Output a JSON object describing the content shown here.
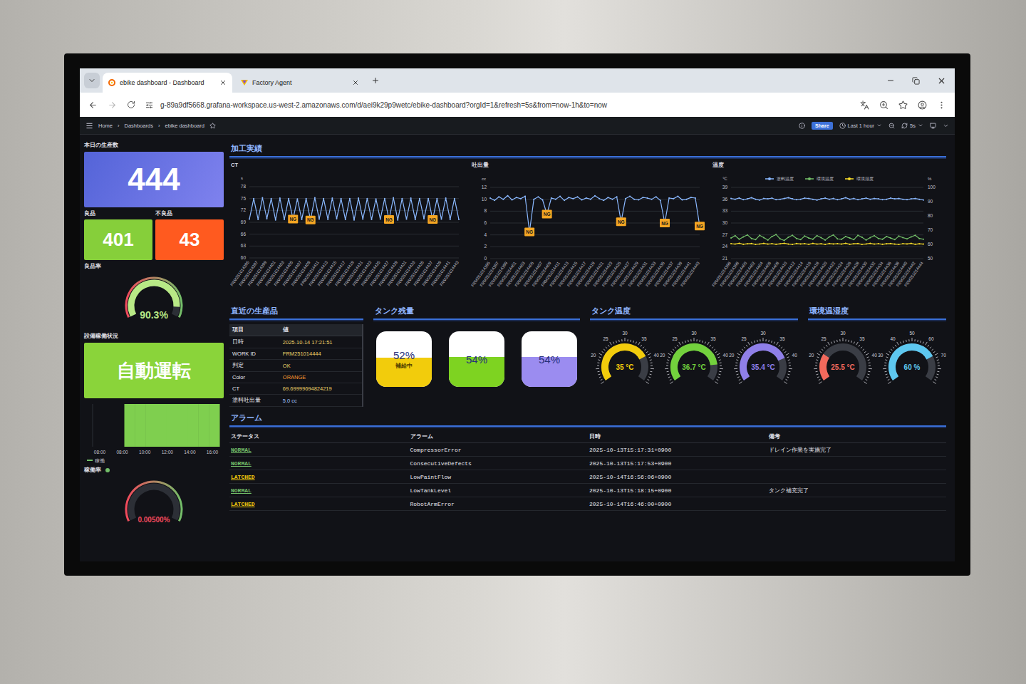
{
  "window": {
    "tabs": [
      {
        "label": "ebike dashboard - Dashboard",
        "selected": true
      },
      {
        "label": "Factory Agent",
        "selected": false
      }
    ],
    "url": "g-89a9df5668.grafana-workspace.us-west-2.amazonaws.com/d/aei9k29p9wetc/ebike-dashboard?orgId=1&refresh=5s&from=now-1h&to=now"
  },
  "nav": {
    "breadcrumbs": [
      "Home",
      "Dashboards",
      "ebike dashboard"
    ],
    "separator": "›",
    "share": "Share",
    "time_range": "Last 1 hour",
    "refresh": "5s"
  },
  "stats": {
    "production": {
      "title": "本日の生産数",
      "value": "444"
    },
    "good": {
      "title": "良品",
      "value": "401"
    },
    "defect": {
      "title": "不良品",
      "value": "43"
    },
    "yield": {
      "title": "良品率",
      "value": "90.3%",
      "level": 0.903,
      "color": "#b8e986"
    },
    "status": {
      "title": "設備稼働状況",
      "value": "自動運転"
    },
    "uptime_chart": {
      "ticks": [
        "08:00",
        "08:00",
        "10:00",
        "12:00",
        "14:00",
        "16:00"
      ],
      "values": [
        0,
        0,
        0,
        1,
        1,
        1,
        1,
        1,
        1,
        1,
        1,
        1
      ],
      "legend": "稼働"
    },
    "uptime": {
      "title": "稼働率",
      "value": "0.00500%",
      "level": 5e-05,
      "color": "#f2495c"
    }
  },
  "processing": {
    "title": "加工実績",
    "charts": [
      {
        "title": "CT",
        "unit": "s",
        "y_ticks": [
          "78",
          "75",
          "72",
          "69",
          "66",
          "63",
          "60"
        ],
        "series": [
          {
            "name": "CT",
            "axis": "left",
            "color": "#8ab8ff",
            "values": [
              69.8,
              75.0,
              69.7,
              75.2,
              69.9,
              75.0,
              69.6,
              75.1,
              69.7,
              75.0,
              69.8,
              74.9,
              69.7,
              75.0,
              69.6,
              75.2,
              69.8,
              75.0,
              69.7,
              75.1,
              69.9,
              75.0,
              69.7,
              75.0,
              69.6,
              75.1,
              69.8,
              75.0,
              69.7,
              74.9,
              69.8,
              75.0,
              69.7,
              75.2,
              69.6,
              75.0,
              69.8,
              75.1,
              69.7,
              75.0,
              69.9,
              75.0,
              69.7,
              75.0,
              69.8,
              75.1,
              69.7,
              75.0,
              69.7
            ]
          }
        ],
        "markers": [
          {
            "index": 10,
            "label": "NG"
          },
          {
            "index": 14,
            "label": "NG"
          },
          {
            "index": 32,
            "label": "NG"
          },
          {
            "index": 42,
            "label": "NG"
          }
        ],
        "labels": [
          "FRM251014395",
          "FRM251014397",
          "FRM251014399",
          "FRM251014401",
          "FRM251014403",
          "FRM251014405",
          "FRM251014407",
          "FRM251014409",
          "FRM251014411",
          "FRM251014413",
          "FRM251014415",
          "FRM251014417",
          "FRM251014419",
          "FRM251014421",
          "FRM251014423",
          "FRM251014425",
          "FRM251014427",
          "FRM251014429",
          "FRM251014431",
          "FRM251014433",
          "FRM251014435",
          "FRM251014437",
          "FRM251014439",
          "FRM251014441",
          "FRM251014443"
        ]
      },
      {
        "title": "吐出量",
        "unit": "cc",
        "y_ticks": [
          "12",
          "10",
          "8",
          "6",
          "4",
          "2",
          "0"
        ],
        "series": [
          {
            "name": "吐出量",
            "axis": "left",
            "color": "#8ab8ff",
            "values": [
              10.2,
              9.8,
              10.4,
              10.0,
              10.6,
              9.9,
              10.3,
              10.1,
              10.5,
              4.5,
              10.0,
              10.4,
              9.9,
              7.5,
              10.2,
              10.0,
              10.5,
              9.8,
              10.3,
              10.1,
              10.4,
              9.9,
              10.2,
              10.0,
              10.6,
              10.1,
              9.8,
              10.3,
              10.0,
              10.4,
              6.2,
              10.1,
              10.5,
              10.0,
              9.9,
              10.3,
              10.2,
              10.0,
              10.4,
              9.8,
              6.0,
              10.2,
              10.1,
              10.5,
              9.9,
              10.0,
              10.3,
              10.2,
              5.5
            ]
          }
        ],
        "markers": [
          {
            "index": 9,
            "label": "NG"
          },
          {
            "index": 13,
            "label": "NG"
          },
          {
            "index": 30,
            "label": "NG"
          },
          {
            "index": 40,
            "label": "NG"
          },
          {
            "index": 48,
            "label": "NG"
          }
        ],
        "labels": [
          "FRM251014395",
          "FRM251014397",
          "FRM251014399",
          "FRM251014401",
          "FRM251014403",
          "FRM251014405",
          "FRM251014407",
          "FRM251014409",
          "FRM251014411",
          "FRM251014413",
          "FRM251014415",
          "FRM251014417",
          "FRM251014419",
          "FRM251014421",
          "FRM251014423",
          "FRM251014425",
          "FRM251014427",
          "FRM251014429",
          "FRM251014431",
          "FRM251014433",
          "FRM251014435",
          "FRM251014437",
          "FRM251014439",
          "FRM251014441",
          "FRM251014443"
        ]
      },
      {
        "title": "温度",
        "unit": "℃",
        "right_unit": "%",
        "y_ticks": [
          "39",
          "36",
          "33",
          "30",
          "27",
          "24",
          "21"
        ],
        "right_ticks": [
          "100",
          "90",
          "80",
          "70",
          "60",
          "50"
        ],
        "legend": true,
        "series": [
          {
            "name": "塗料温度",
            "axis": "left",
            "color": "#8ab8ff",
            "values": [
              36.2,
              36.0,
              36.3,
              35.9,
              36.1,
              36.4,
              36.0,
              35.8,
              36.2,
              36.1,
              36.3,
              35.9,
              36.0,
              36.2,
              36.4,
              36.1,
              35.9,
              36.0,
              36.3,
              36.2,
              36.0,
              35.8,
              36.1,
              36.3,
              36.0,
              36.2,
              35.9,
              36.1,
              36.4,
              36.0,
              36.2,
              35.9,
              36.1,
              36.3,
              36.0,
              36.2,
              36.1,
              35.9,
              36.0,
              36.3,
              36.1,
              36.2,
              36.0,
              35.9,
              36.1,
              36.2,
              36.0,
              35.8
            ]
          },
          {
            "name": "環境温度",
            "axis": "left",
            "color": "#73bf69",
            "values": [
              26.2,
              26.8,
              25.9,
              26.5,
              27.0,
              26.1,
              25.8,
              26.9,
              26.3,
              25.7,
              26.6,
              27.1,
              26.0,
              25.6,
              26.4,
              26.9,
              26.1,
              25.8,
              26.7,
              26.2,
              25.9,
              26.8,
              26.3,
              25.7,
              26.5,
              27.0,
              26.0,
              25.9,
              26.6,
              26.2,
              25.8,
              26.9,
              26.4,
              25.7,
              26.3,
              26.8,
              26.1,
              25.9,
              26.6,
              26.2,
              25.8,
              26.7,
              26.3,
              26.0,
              26.5,
              26.9,
              26.1,
              25.9
            ]
          },
          {
            "name": "環境湿度",
            "axis": "right",
            "color": "#fade2a",
            "values": [
              60.5,
              60.2,
              60.8,
              60.1,
              60.4,
              60.6,
              60.0,
              60.3,
              60.7,
              60.2,
              60.5,
              60.1,
              60.4,
              60.8,
              60.2,
              60.0,
              60.6,
              60.3,
              60.5,
              60.1,
              60.7,
              60.2,
              60.4,
              60.0,
              60.6,
              60.3,
              60.5,
              60.2,
              60.8,
              60.1,
              60.4,
              60.6,
              60.0,
              60.3,
              60.7,
              60.2,
              60.5,
              60.1,
              60.4,
              60.6,
              60.2,
              60.0,
              60.5,
              60.3,
              60.7,
              60.1,
              60.4,
              60.2
            ]
          }
        ],
        "markers": [],
        "labels": [
          "FRM251014396",
          "FRM251014398",
          "FRM251014400",
          "FRM251014402",
          "FRM251014404",
          "FRM251014406",
          "FRM251014408",
          "FRM251014410",
          "FRM251014412",
          "FRM251014414",
          "FRM251014416",
          "FRM251014418",
          "FRM251014420",
          "FRM251014422",
          "FRM251014424",
          "FRM251014426",
          "FRM251014428",
          "FRM251014430",
          "FRM251014432",
          "FRM251014434",
          "FRM251014436",
          "FRM251014438",
          "FRM251014440",
          "FRM251014442",
          "FRM251014444"
        ]
      }
    ]
  },
  "recent": {
    "title": "直近の生産品",
    "columns": [
      "項目",
      "値"
    ],
    "rows": [
      {
        "item": "日時",
        "value": "2025-10-14 17:21:51",
        "color": "#f0d46a"
      },
      {
        "item": "WORK ID",
        "value": "FRM251014444",
        "color": "#f0d46a"
      },
      {
        "item": "判定",
        "value": "OK",
        "color": "#f0d46a"
      },
      {
        "item": "Color",
        "value": "ORANGE",
        "color": "#ff9830"
      },
      {
        "item": "CT",
        "value": "69.69999694824219",
        "color": "#f0d46a"
      },
      {
        "item": "塗料吐出量",
        "value": "5.0 cc",
        "color": "#a8c8ff"
      }
    ]
  },
  "tanks": {
    "title": "タンク残量",
    "items": [
      {
        "value": "52%",
        "level": 0.52,
        "color": "#f2cc0c",
        "note": "補給中"
      },
      {
        "value": "54%",
        "level": 0.54,
        "color": "#7ed321"
      },
      {
        "value": "54%",
        "level": 0.54,
        "color": "#9b8cf0"
      }
    ]
  },
  "tank_temps": {
    "title": "タンク温度",
    "gauges": [
      {
        "value": "35 °C",
        "level": 0.75,
        "color": "#f2cc0c",
        "ticks": [
          "20",
          "25",
          "30",
          "35",
          "40"
        ]
      },
      {
        "value": "36.7 °C",
        "level": 0.835,
        "color": "#73d13d",
        "ticks": [
          "20",
          "25",
          "30",
          "35",
          "40"
        ]
      },
      {
        "value": "35.4 °C",
        "level": 0.77,
        "color": "#8f7fe8",
        "ticks": [
          "20",
          "25",
          "30",
          "35",
          "40"
        ]
      }
    ]
  },
  "environment": {
    "title": "環境温湿度",
    "gauges": [
      {
        "value": "25.5 °C",
        "level": 0.275,
        "color": "#f2695c",
        "ticks": [
          "20",
          "25",
          "30",
          "35",
          "40"
        ]
      },
      {
        "value": "60 %",
        "level": 0.75,
        "color": "#5ec8f0",
        "ticks": [
          "30",
          "40",
          "50",
          "60",
          "70"
        ]
      }
    ]
  },
  "alarms": {
    "title": "アラーム",
    "columns": [
      "ステータス",
      "アラーム",
      "日時",
      "備考"
    ],
    "rows": [
      {
        "status": "NORMAL",
        "color": "#73bf69",
        "name": "CompressorError",
        "time": "2025-10-13T15:17:31+0900",
        "note": "ドレイン作業を実施完了"
      },
      {
        "status": "NORMAL",
        "color": "#73bf69",
        "name": "ConsecutiveDefects",
        "time": "2025-10-13T15:17:53+0900",
        "note": ""
      },
      {
        "status": "LATCHED",
        "color": "#f2cc0c",
        "name": "LowPaintFlow",
        "time": "2025-10-14T16:56:06+0900",
        "note": ""
      },
      {
        "status": "NORMAL",
        "color": "#73bf69",
        "name": "LowTankLevel",
        "time": "2025-10-13T15:18:15+0900",
        "note": "タンク補充完了"
      },
      {
        "status": "LATCHED",
        "color": "#f2cc0c",
        "name": "RobotArmError",
        "time": "2025-10-14T16:46:00+0900",
        "note": ""
      }
    ]
  }
}
